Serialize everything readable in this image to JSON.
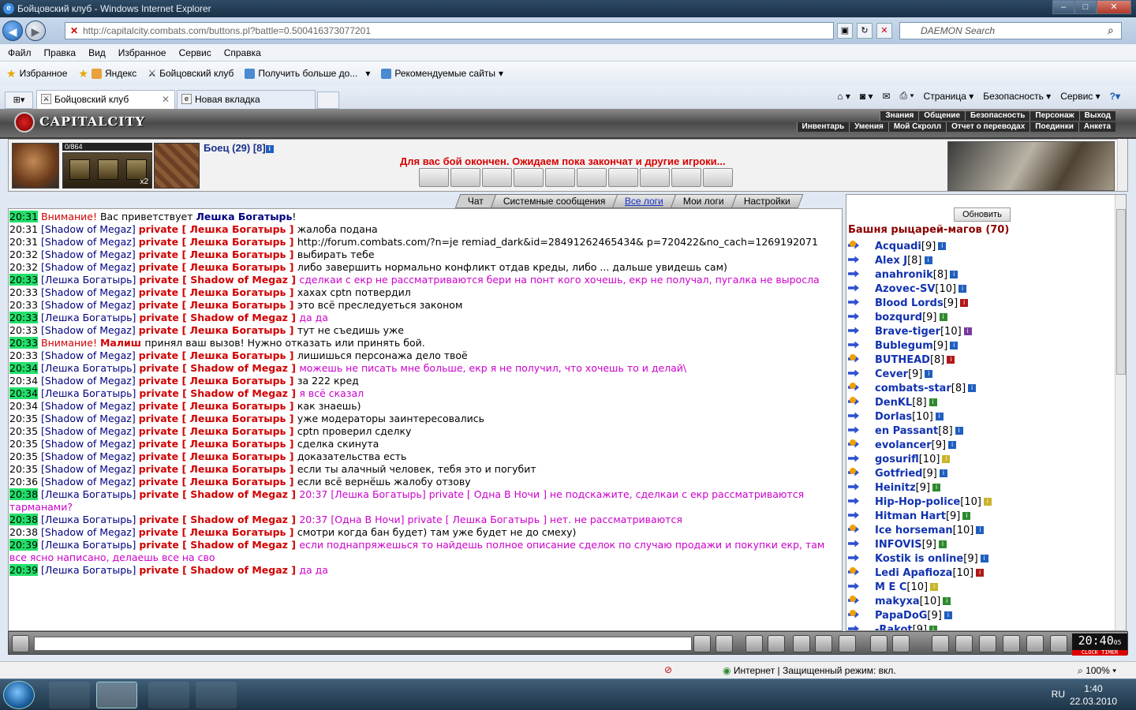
{
  "window": {
    "title": "Бойцовский клуб - Windows Internet Explorer"
  },
  "address": {
    "url": "http://capitalcity.combats.com/buttons.pl?battle=0.500416373077201",
    "search_placeholder": "DAEMON Search"
  },
  "menu": [
    "Файл",
    "Правка",
    "Вид",
    "Избранное",
    "Сервис",
    "Справка"
  ],
  "favorites": {
    "label": "Избранное",
    "items": [
      "Яндекс",
      "Бойцовский клуб",
      "Получить больше до...",
      "Рекомендуемые сайты"
    ]
  },
  "tabs": [
    {
      "label": "Бойцовский клуб"
    },
    {
      "label": "Новая вкладка"
    }
  ],
  "toolbar": {
    "page": "Страница",
    "safety": "Безопасность",
    "tools": "Сервис"
  },
  "game": {
    "logo": "CAPITALCITY",
    "nav_top": [
      "Знания",
      "Общение",
      "Безопасность",
      "Персонаж",
      "Выход"
    ],
    "nav_bottom": [
      "Инвентарь",
      "Умения",
      "Мой Скролл",
      "Отчет о переводах",
      "Поединки",
      "Анкета"
    ],
    "hp": "0/864",
    "slot_count": "x2",
    "fighter": "Боец (29) [8]",
    "battle_message": "Для вас бой окончен. Ожидаем пока закончат и другие игроки...",
    "chat_tabs": [
      "Чат",
      "Системные сообщения",
      "Все логи",
      "Мои логи",
      "Настройки"
    ],
    "refresh": "Обновить",
    "room_title": "Башня рыцарей-магов (70)",
    "clock": "20:40",
    "clock_sub": "CLOCK TIMER",
    "clock_sec": "05"
  },
  "chat": [
    {
      "t": "20:31",
      "hl": true,
      "parts": [
        [
          "wn",
          "Внимание! "
        ],
        [
          "",
          "Вас приветствует "
        ],
        [
          "b",
          "Лешка Богатырь"
        ],
        [
          "",
          "!"
        ]
      ]
    },
    {
      "t": "20:31",
      "hl": false,
      "parts": [
        [
          "sn",
          "[Shadow of Megaz] "
        ],
        [
          "pv",
          "private [ Лешка Богатырь ] "
        ],
        [
          "",
          "жалоба подана"
        ]
      ]
    },
    {
      "t": "20:31",
      "hl": false,
      "parts": [
        [
          "sn",
          "[Shadow of Megaz] "
        ],
        [
          "pv",
          "private [ Лешка Богатырь ] "
        ],
        [
          "",
          "http://forum.combats.com/?n=je remiad_dark&id=28491262465434& p=720422&no_cach=1269192071"
        ]
      ]
    },
    {
      "t": "20:32",
      "hl": false,
      "parts": [
        [
          "sn",
          "[Shadow of Megaz] "
        ],
        [
          "pv",
          "private [ Лешка Богатырь ] "
        ],
        [
          "",
          "выбирать тебе"
        ]
      ]
    },
    {
      "t": "20:32",
      "hl": false,
      "parts": [
        [
          "sn",
          "[Shadow of Megaz] "
        ],
        [
          "pv",
          "private [ Лешка Богатырь ] "
        ],
        [
          "",
          "либо завершить нормально конфликт отдав креды, либо ... дальше увидешь сам)"
        ]
      ]
    },
    {
      "t": "20:33",
      "hl": true,
      "parts": [
        [
          "sn",
          "[Лешка Богатырь] "
        ],
        [
          "pv",
          "private [ Shadow of Megaz ] "
        ],
        [
          "pk",
          "сделкаи с екр не рассматриваются бери на понт кого хочешь, екр не получал, пугалка не выросла"
        ]
      ]
    },
    {
      "t": "20:33",
      "hl": false,
      "parts": [
        [
          "sn",
          "[Shadow of Megaz] "
        ],
        [
          "pv",
          "private [ Лешка Богатырь ] "
        ],
        [
          "",
          "хахах cptn потвердил"
        ]
      ]
    },
    {
      "t": "20:33",
      "hl": false,
      "parts": [
        [
          "sn",
          "[Shadow of Megaz] "
        ],
        [
          "pv",
          "private [ Лешка Богатырь ] "
        ],
        [
          "",
          "это всё преследуеться законом"
        ]
      ]
    },
    {
      "t": "20:33",
      "hl": true,
      "parts": [
        [
          "sn",
          "[Лешка Богатырь] "
        ],
        [
          "pv",
          "private [ Shadow of Megaz ] "
        ],
        [
          "pk",
          "да да"
        ]
      ]
    },
    {
      "t": "20:33",
      "hl": false,
      "parts": [
        [
          "sn",
          "[Shadow of Megaz] "
        ],
        [
          "pv",
          "private [ Лешка Богатырь ] "
        ],
        [
          "",
          "тут не съедишь уже"
        ]
      ]
    },
    {
      "t": "20:33",
      "hl": true,
      "parts": [
        [
          "wn",
          "Внимание! "
        ],
        [
          "pv",
          "Малиш "
        ],
        [
          "",
          "принял ваш вызов! Нужно отказать или принять бой."
        ]
      ]
    },
    {
      "t": "20:33",
      "hl": false,
      "parts": [
        [
          "sn",
          "[Shadow of Megaz] "
        ],
        [
          "pv",
          "private [ Лешка Богатырь ] "
        ],
        [
          "",
          "лишишься персонажа дело твоё"
        ]
      ]
    },
    {
      "t": "20:34",
      "hl": true,
      "parts": [
        [
          "sn",
          "[Лешка Богатырь] "
        ],
        [
          "pv",
          "private [ Shadow of Megaz ] "
        ],
        [
          "pk",
          "можешь не писать мне больше, екр я не получил, что хочешь то и делай\\"
        ]
      ]
    },
    {
      "t": "20:34",
      "hl": false,
      "parts": [
        [
          "sn",
          "[Shadow of Megaz] "
        ],
        [
          "pv",
          "private [ Лешка Богатырь ] "
        ],
        [
          "",
          "за 222 кред"
        ]
      ]
    },
    {
      "t": "20:34",
      "hl": true,
      "parts": [
        [
          "sn",
          "[Лешка Богатырь] "
        ],
        [
          "pv",
          "private [ Shadow of Megaz ] "
        ],
        [
          "pk",
          "я всё сказал"
        ]
      ]
    },
    {
      "t": "20:34",
      "hl": false,
      "parts": [
        [
          "sn",
          "[Shadow of Megaz] "
        ],
        [
          "pv",
          "private [ Лешка Богатырь ] "
        ],
        [
          "",
          "как знаешь)"
        ]
      ]
    },
    {
      "t": "20:35",
      "hl": false,
      "parts": [
        [
          "sn",
          "[Shadow of Megaz] "
        ],
        [
          "pv",
          "private [ Лешка Богатырь ] "
        ],
        [
          "",
          "уже модераторы заинтересовались"
        ]
      ]
    },
    {
      "t": "20:35",
      "hl": false,
      "parts": [
        [
          "sn",
          "[Shadow of Megaz] "
        ],
        [
          "pv",
          "private [ Лешка Богатырь ] "
        ],
        [
          "",
          "cptn проверил сделку"
        ]
      ]
    },
    {
      "t": "20:35",
      "hl": false,
      "parts": [
        [
          "sn",
          "[Shadow of Megaz] "
        ],
        [
          "pv",
          "private [ Лешка Богатырь ] "
        ],
        [
          "",
          "сделка скинута"
        ]
      ]
    },
    {
      "t": "20:35",
      "hl": false,
      "parts": [
        [
          "sn",
          "[Shadow of Megaz] "
        ],
        [
          "pv",
          "private [ Лешка Богатырь ] "
        ],
        [
          "",
          "доказательства есть"
        ]
      ]
    },
    {
      "t": "20:35",
      "hl": false,
      "parts": [
        [
          "sn",
          "[Shadow of Megaz] "
        ],
        [
          "pv",
          "private [ Лешка Богатырь ] "
        ],
        [
          "",
          "если ты алачный человек, тебя это и погубит"
        ]
      ]
    },
    {
      "t": "20:36",
      "hl": false,
      "parts": [
        [
          "sn",
          "[Shadow of Megaz] "
        ],
        [
          "pv",
          "private [ Лешка Богатырь ] "
        ],
        [
          "",
          "если всё вернёшь жалобу отзову"
        ]
      ]
    },
    {
      "t": "20:38",
      "hl": true,
      "parts": [
        [
          "sn",
          "[Лешка Богатырь] "
        ],
        [
          "pv",
          "private [ Shadow of Megaz ] "
        ],
        [
          "pk",
          "20:37 [Лешка Богатырь] private [ Одна В Ночи ] не подскажите, сделкаи с екр рассматриваются тарманами?"
        ]
      ]
    },
    {
      "t": "20:38",
      "hl": true,
      "parts": [
        [
          "sn",
          "[Лешка Богатырь] "
        ],
        [
          "pv",
          "private [ Shadow of Megaz ] "
        ],
        [
          "pk",
          "20:37 [Одна В Ночи] private [ Лешка Богатырь ] нет. не рассматриваются"
        ]
      ]
    },
    {
      "t": "20:38",
      "hl": false,
      "parts": [
        [
          "sn",
          "[Shadow of Megaz] "
        ],
        [
          "pv",
          "private [ Лешка Богатырь ] "
        ],
        [
          "",
          "смотри когда бан будет) там уже будет не до смеху)"
        ]
      ]
    },
    {
      "t": "20:39",
      "hl": true,
      "parts": [
        [
          "sn",
          "[Лешка Богатырь] "
        ],
        [
          "pv",
          "private [ Shadow of Megaz ] "
        ],
        [
          "pk",
          "если поднапряжешься то найдешь полное описание сделок по случаю продажи и покупки екр, там все ясно написано, делаешь все на сво"
        ]
      ]
    },
    {
      "t": "20:39",
      "hl": true,
      "parts": [
        [
          "sn",
          "[Лешка Богатырь] "
        ],
        [
          "pv",
          "private [ Shadow of Megaz ] "
        ],
        [
          "pk",
          "да да"
        ]
      ]
    }
  ],
  "users": [
    {
      "n": "Acquadi",
      "l": "[9]",
      "c": "b",
      "f": true
    },
    {
      "n": "Alex J",
      "l": "[8]",
      "c": "b"
    },
    {
      "n": "anahronik",
      "l": "[8]",
      "c": "b"
    },
    {
      "n": "Azovec-SV",
      "l": "[10]",
      "c": "b"
    },
    {
      "n": "Blood Lords",
      "l": "[9]",
      "c": "r"
    },
    {
      "n": "bozqurd",
      "l": "[9]",
      "c": "g"
    },
    {
      "n": "Brave-tiger",
      "l": "[10]",
      "c": "p"
    },
    {
      "n": "Bublegum",
      "l": "[9]",
      "c": "b"
    },
    {
      "n": "BUTHEAD",
      "l": "[8]",
      "c": "r",
      "f": true
    },
    {
      "n": "Cever",
      "l": "[9]",
      "c": "b"
    },
    {
      "n": "combats-star",
      "l": "[8]",
      "c": "b",
      "f": true
    },
    {
      "n": "DenKL",
      "l": "[8]",
      "c": "g",
      "f": true
    },
    {
      "n": "Dorlas",
      "l": "[10]",
      "c": "b"
    },
    {
      "n": "en Passant",
      "l": "[8]",
      "c": "b"
    },
    {
      "n": "evolancer",
      "l": "[9]",
      "c": "b",
      "f": true
    },
    {
      "n": "gosurifl",
      "l": "[10]",
      "c": "y"
    },
    {
      "n": "Gotfried",
      "l": "[9]",
      "c": "b",
      "f": true
    },
    {
      "n": "Heinitz",
      "l": "[9]",
      "c": "g"
    },
    {
      "n": "Hip-Hop-police",
      "l": "[10]",
      "c": "y"
    },
    {
      "n": "Hitman Hart",
      "l": "[9]",
      "c": "g"
    },
    {
      "n": "Ice horseman",
      "l": "[10]",
      "c": "b",
      "f": true
    },
    {
      "n": "INFOVIS",
      "l": "[9]",
      "c": "g"
    },
    {
      "n": "Kostik is online",
      "l": "[9]",
      "c": "b"
    },
    {
      "n": "Ledi Apafioza",
      "l": "[10]",
      "c": "r",
      "f": true
    },
    {
      "n": "M E C",
      "l": "[10]",
      "c": "y"
    },
    {
      "n": "makyxa",
      "l": "[10]",
      "c": "g",
      "f": true
    },
    {
      "n": "PapaDoG",
      "l": "[9]",
      "c": "b",
      "f": true
    },
    {
      "n": "-Rakot",
      "l": "[9]",
      "c": "g"
    }
  ],
  "status": {
    "zone": "Интернет | Защищенный режим: вкл.",
    "zoom": "100%"
  },
  "taskbar": {
    "lang": "RU",
    "time": "1:40",
    "date": "22.03.2010"
  },
  "colors": {
    "timestamp_highlight": "#22e06a",
    "private": "#d00000",
    "nick": "#000080",
    "pink": "#cc00cc"
  }
}
